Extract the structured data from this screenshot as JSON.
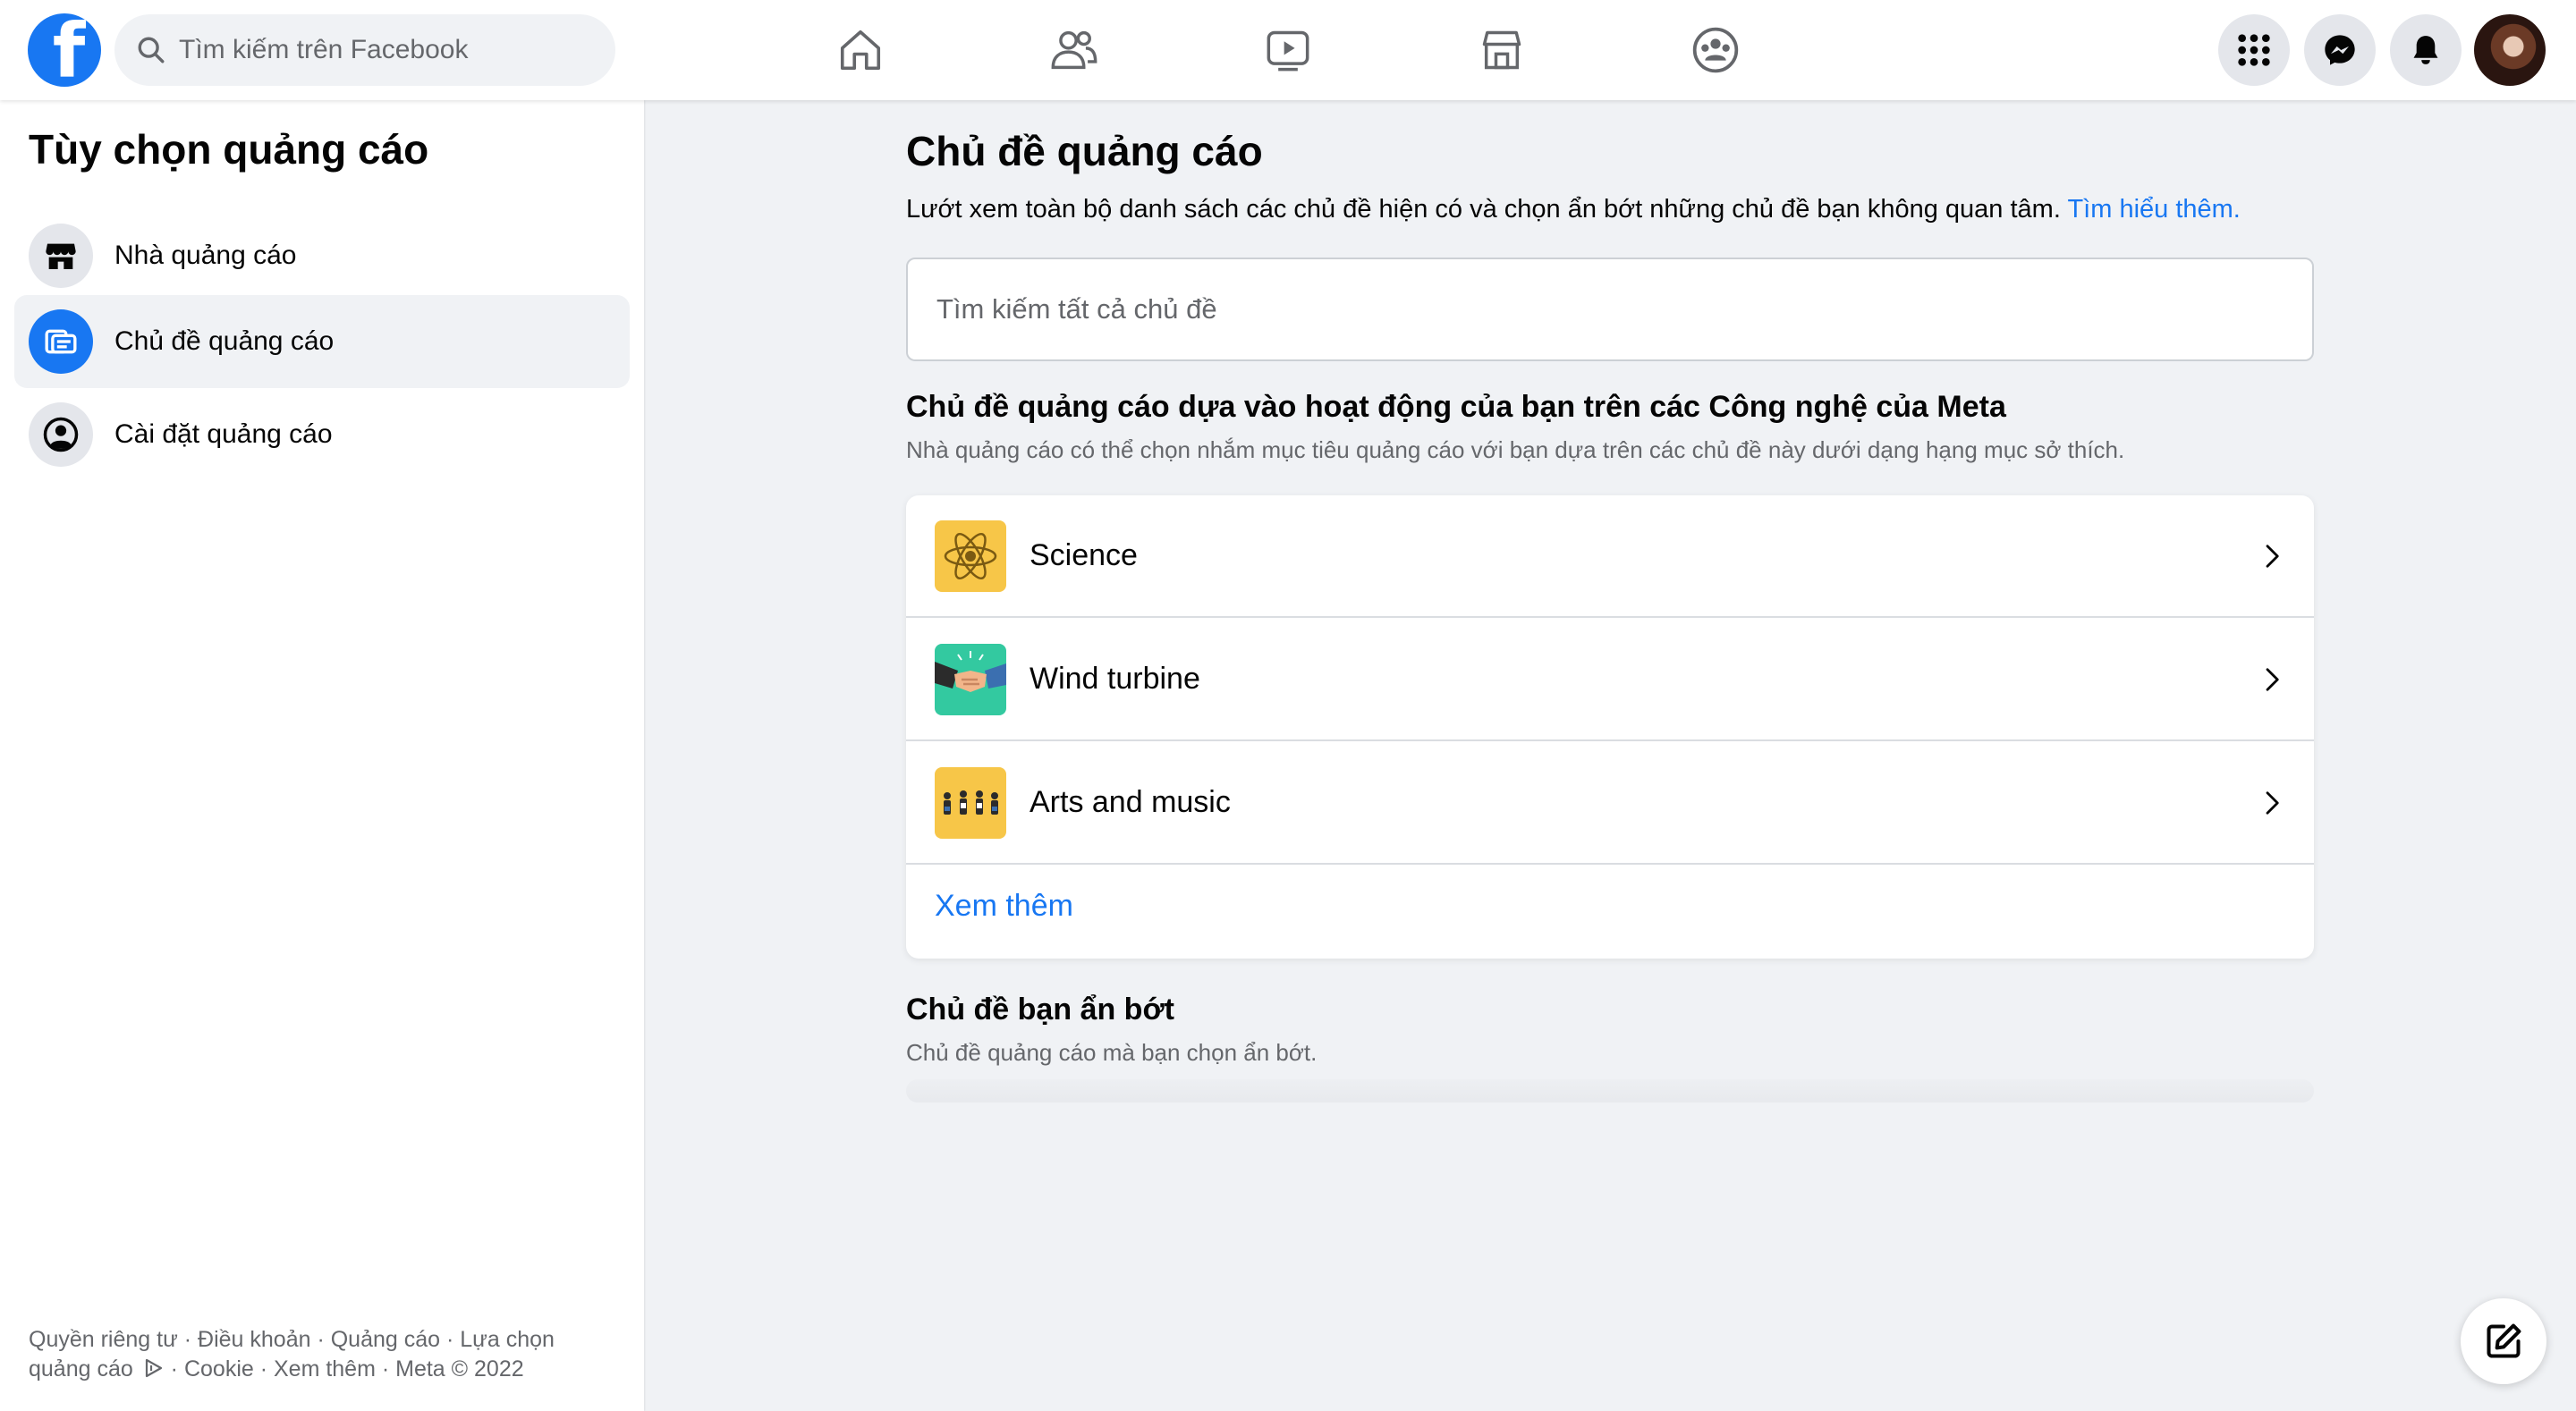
{
  "topbar": {
    "search_placeholder": "Tìm kiếm trên Facebook",
    "nav_icons": [
      "home-icon",
      "friends-icon",
      "watch-icon",
      "marketplace-icon",
      "groups-icon"
    ],
    "action_icons": [
      "menu-grid-icon",
      "messenger-icon",
      "notifications-icon"
    ],
    "brand_color": "#1877f2"
  },
  "sidebar": {
    "title": "Tùy chọn quảng cáo",
    "items": [
      {
        "label": "Nhà quảng cáo",
        "icon": "store-icon",
        "active": false
      },
      {
        "label": "Chủ đề quảng cáo",
        "icon": "ad-topics-icon",
        "active": true
      },
      {
        "label": "Cài đặt quảng cáo",
        "icon": "person-settings-icon",
        "active": false
      }
    ],
    "footer": {
      "line1": "Quyền riêng tư · Điều khoản · Quảng cáo · Lựa chọn",
      "line2a": "quảng cáo",
      "line2b": " · Cookie · Xem thêm · Meta © 2022"
    }
  },
  "main": {
    "title": "Chủ đề quảng cáo",
    "description": "Lướt xem toàn bộ danh sách các chủ đề hiện có và chọn ẩn bớt những chủ đề bạn không quan tâm.",
    "learn_more": "Tìm hiểu thêm.",
    "topic_search_placeholder": "Tìm kiếm tất cả chủ đề",
    "activity_section": {
      "title": "Chủ đề quảng cáo dựa vào hoạt động của bạn trên các Công nghệ của Meta",
      "subtitle": "Nhà quảng cáo có thể chọn nhắm mục tiêu quảng cáo với bạn dựa trên các chủ đề này dưới dạng hạng mục sở thích."
    },
    "topics": [
      {
        "name": "Science",
        "icon": "atom-icon"
      },
      {
        "name": "Wind turbine",
        "icon": "handshake-icon"
      },
      {
        "name": "Arts and music",
        "icon": "people-group-icon"
      }
    ],
    "see_more": "Xem thêm",
    "hidden_section": {
      "title": "Chủ đề bạn ẩn bớt",
      "subtitle": "Chủ đề quảng cáo mà bạn chọn ẩn bớt."
    }
  }
}
